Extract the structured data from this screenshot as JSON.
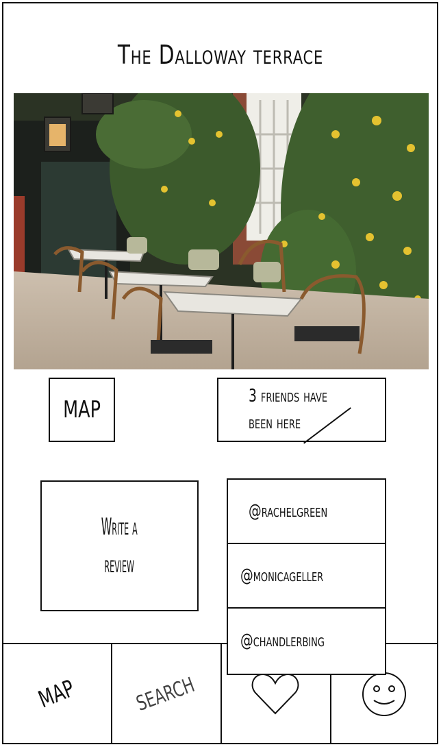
{
  "header": {
    "title": "The Dalloway terrace"
  },
  "photo": {
    "alt": "Outdoor terrace dining with lemon tree wall"
  },
  "actions": {
    "map_label": "MAP",
    "friends_line1": "3 friends have",
    "friends_line2": "been here",
    "review_line1": "Write a",
    "review_line2": "review"
  },
  "friends": [
    {
      "handle": "@rachelgreen"
    },
    {
      "handle": "@monicageller"
    },
    {
      "handle": "@chandlerbing"
    }
  ],
  "tabbar": {
    "tabs": [
      {
        "label": "MAP",
        "icon": "map"
      },
      {
        "label": "SEARCH",
        "icon": "search"
      },
      {
        "label": "",
        "icon": "heart-icon"
      },
      {
        "label": "",
        "icon": "smiley-icon"
      }
    ]
  }
}
